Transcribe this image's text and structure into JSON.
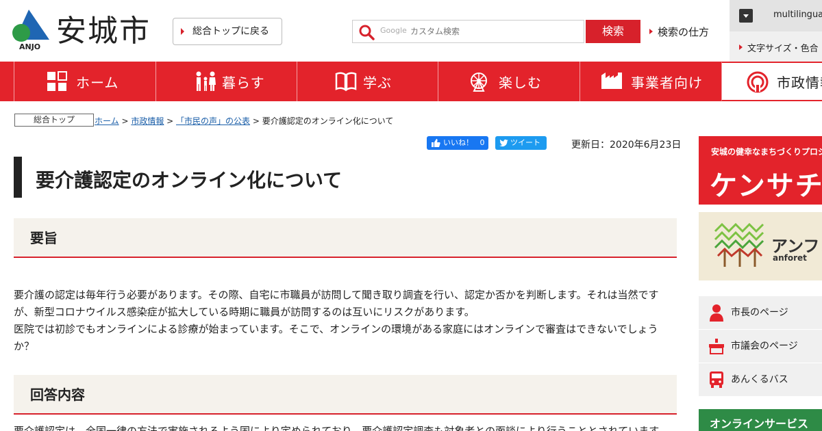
{
  "header": {
    "logo_text": "安城市",
    "logo_sub": "ANJO",
    "top_link": "総合トップに戻る",
    "search_placeholder": "カスタム検索",
    "search_brand": "Google",
    "search_button": "検索",
    "search_help": "検索の仕方",
    "multilingual": "multilingual",
    "font_size_link": "文字サイズ・色合"
  },
  "nav": {
    "items": [
      {
        "label": "ホーム",
        "icon": "grid-icon"
      },
      {
        "label": "暮らす",
        "icon": "family-icon"
      },
      {
        "label": "学ぶ",
        "icon": "book-icon"
      },
      {
        "label": "楽しむ",
        "icon": "ferris-wheel-icon"
      },
      {
        "label": "事業者向け",
        "icon": "factory-icon"
      },
      {
        "label": "市政情報",
        "icon": "city-emblem-icon"
      }
    ],
    "active_index": 5
  },
  "breadcrumb": {
    "top_box": "総合トップ",
    "home": "ホーム",
    "sep1": " > ",
    "cat": "市政情報",
    "sep2": " > ",
    "sub": "「市民の声」の公表",
    "sep3": " > ",
    "current": "要介護認定のオンライン化について"
  },
  "social": {
    "like_label": "いいね！",
    "like_count": "0",
    "tweet_label": "ツイート"
  },
  "update_date": "更新日：2020年6月23日",
  "page_title": "要介護認定のオンライン化について",
  "sections": [
    {
      "heading": "要旨",
      "paragraphs": [
        "要介護の認定は毎年行う必要があります。その際、自宅に市職員が訪問して聞き取り調査を行い、認定か否かを判断します。それは当然ですが、新型コロナウイルス感染症が拡大している時期に職員が訪問するのは互いにリスクがあります。",
        "医院では初診でもオンラインによる診療が始まっています。そこで、オンラインの環境がある家庭にはオンラインで審査はできないでしょうか？"
      ]
    },
    {
      "heading": "回答内容",
      "paragraphs": [
        "要介護認定は、全国一律の方法で実施されるよう国により定められており、要介護認定調査も対象者との面談により行うこととされています。"
      ]
    }
  ],
  "sidebar": {
    "banner1_small": "安城の健幸なまちづくりプロジェクト",
    "banner1_big": "ケンサチ",
    "banner2_jp": "アンフォ",
    "banner2_en": "anforet",
    "links": [
      {
        "label": "市長のページ",
        "icon": "person-icon"
      },
      {
        "label": "市議会のページ",
        "icon": "assembly-icon"
      },
      {
        "label": "あんくるバス",
        "icon": "bus-icon"
      }
    ],
    "online_service": "オンラインサービス"
  },
  "colors": {
    "brand_red": "#e3232b",
    "link_blue": "#1a5ea8",
    "green": "#2e8b46"
  }
}
